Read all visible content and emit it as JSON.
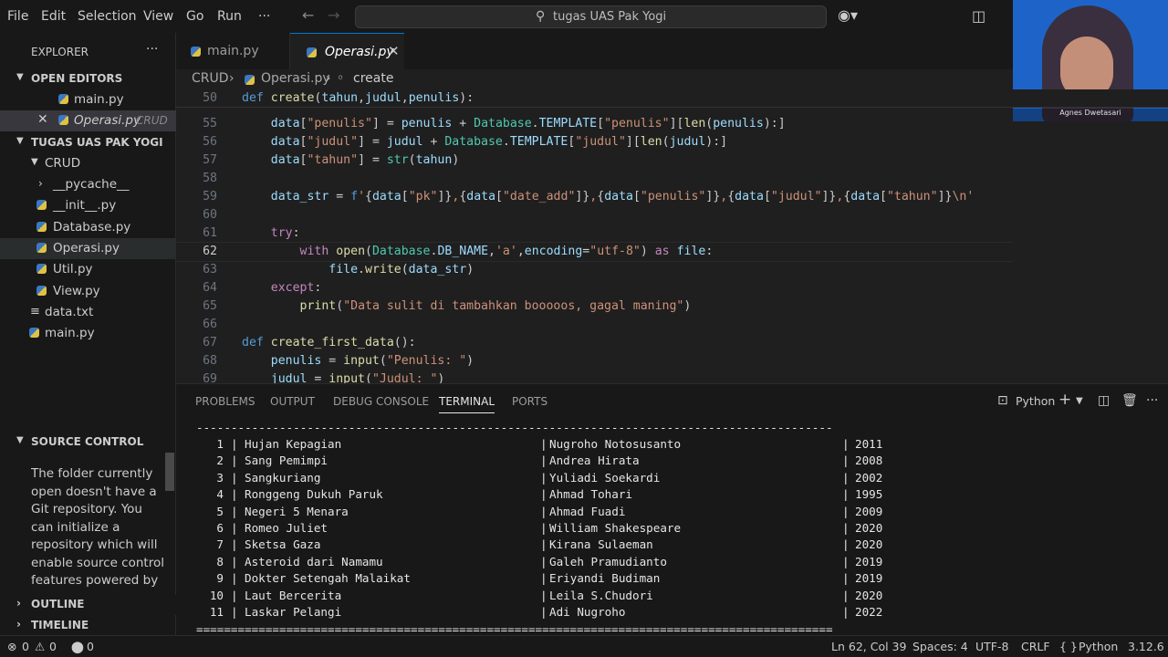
{
  "menu": [
    "File",
    "Edit",
    "Selection",
    "View",
    "Go",
    "Run",
    "···"
  ],
  "search": {
    "text": "tugas UAS Pak Yogi",
    "icon": "search-icon"
  },
  "explorer": {
    "header": "EXPLORER",
    "open_editors_title": "OPEN EDITORS",
    "open_editors": [
      {
        "label": "main.py"
      },
      {
        "label": "Operasi.py",
        "tag": "CRUD"
      }
    ],
    "project_title": "TUGAS UAS PAK YOGI",
    "tree": [
      {
        "label": "CRUD"
      },
      {
        "label": "__pycache__"
      },
      {
        "label": "__init__.py"
      },
      {
        "label": "Database.py"
      },
      {
        "label": "Operasi.py"
      },
      {
        "label": "Util.py"
      },
      {
        "label": "View.py"
      },
      {
        "label": "data.txt"
      },
      {
        "label": "main.py"
      }
    ],
    "source_control_title": "SOURCE CONTROL",
    "source_control_text": "The folder currently open doesn't have a Git repository. You can initialize a repository which will enable source control features powered by",
    "outline_title": "OUTLINE",
    "timeline_title": "TIMELINE"
  },
  "tabs": [
    {
      "label": "main.py"
    },
    {
      "label": "Operasi.py"
    }
  ],
  "breadcrumb": {
    "folder": "CRUD",
    "file": "Operasi.py",
    "symbol": "create"
  },
  "editor": {
    "sticky_line": "50",
    "lines": [
      "55",
      "56",
      "57",
      "58",
      "59",
      "60",
      "61",
      "62",
      "63",
      "64",
      "65",
      "66",
      "67",
      "68",
      "69"
    ],
    "current_line": "62"
  },
  "panel": {
    "tabs": [
      "PROBLEMS",
      "OUTPUT",
      "DEBUG CONSOLE",
      "TERMINAL",
      "PORTS"
    ],
    "active_tab": "TERMINAL",
    "shell": "Python",
    "top_rule": "--------------------------------------------------------------------------------------------",
    "bottom_rule": "============================================================================================",
    "rows": [
      {
        "no": "1",
        "judul": "Hujan Kepagian",
        "penulis": "Nugroho Notosusanto",
        "tahun": "2011"
      },
      {
        "no": "2",
        "judul": "Sang Pemimpi",
        "penulis": "Andrea Hirata",
        "tahun": "2008"
      },
      {
        "no": "3",
        "judul": "Sangkuriang",
        "penulis": "Yuliadi Soekardi",
        "tahun": "2002"
      },
      {
        "no": "4",
        "judul": "Ronggeng Dukuh Paruk",
        "penulis": "Ahmad Tohari",
        "tahun": "1995"
      },
      {
        "no": "5",
        "judul": "Negeri 5 Menara",
        "penulis": "Ahmad Fuadi",
        "tahun": "2009"
      },
      {
        "no": "6",
        "judul": "Romeo Juliet",
        "penulis": "William Shakespeare",
        "tahun": "2020"
      },
      {
        "no": "7",
        "judul": "Sketsa Gaza",
        "penulis": "Kirana Sulaeman",
        "tahun": "2020"
      },
      {
        "no": "8",
        "judul": "Asteroid dari Namamu",
        "penulis": "Galeh Pramudianto",
        "tahun": "2019"
      },
      {
        "no": "9",
        "judul": "Dokter Setengah Malaikat",
        "penulis": "Eriyandi Budiman",
        "tahun": "2019"
      },
      {
        "no": "10",
        "judul": "Laut Bercerita",
        "penulis": "Leila S.Chudori",
        "tahun": "2020"
      },
      {
        "no": "11",
        "judul": "Laskar Pelangi",
        "penulis": "Adi Nugroho",
        "tahun": "2022"
      }
    ]
  },
  "status": {
    "errors": "0",
    "warnings": "0",
    "ports": "0",
    "cursor": "Ln 62, Col 39",
    "spaces": "Spaces: 4",
    "encoding": "UTF-8",
    "eol": "CRLF",
    "language": "Python",
    "version": "3.12.6"
  },
  "webcam": {
    "name": "Agnes Dwetasari"
  }
}
